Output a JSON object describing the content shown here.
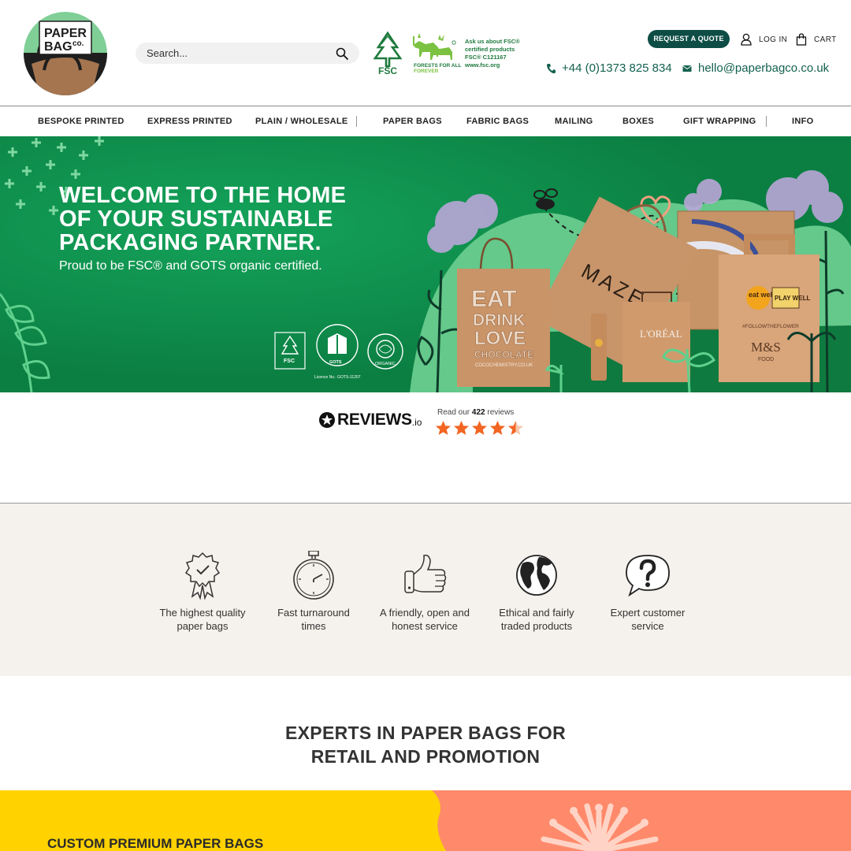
{
  "brand": {
    "logo_line1": "PAPER",
    "logo_line2": "BAG",
    "logo_co": "co."
  },
  "search": {
    "placeholder": "Search..."
  },
  "fsc": {
    "label": "FSC",
    "forests_line1": "FORESTS FOR ALL",
    "forests_line2": "FOREVER",
    "text_lines": [
      "Ask us about FSC®",
      "certified products",
      "FSC® C121167",
      "www.fsc.org"
    ]
  },
  "header": {
    "quote_button": "REQUEST A QUOTE",
    "login": "LOG IN",
    "cart": "CART",
    "phone": "+44 (0)1373 825 834",
    "email": "hello@paperbagco.co.uk"
  },
  "nav": {
    "items": [
      "BESPOKE PRINTED",
      "EXPRESS PRINTED",
      "PLAIN / WHOLESALE",
      "PAPER BAGS",
      "FABRIC BAGS",
      "MAILING",
      "BOXES",
      "GIFT WRAPPING",
      "INFO"
    ]
  },
  "hero": {
    "title_lines": [
      "WELCOME TO THE HOME",
      "OF YOUR SUSTAINABLE",
      "PACKAGING PARTNER."
    ],
    "subtitle": "Proud to be FSC® and GOTS organic certified.",
    "bag_eat": [
      "EAT",
      "DRINK",
      "LOVE",
      "CHOCOLATE"
    ],
    "bag_eat_url": "COCOCHEMISTRY.CO.UK",
    "bag_maze": "MAZE",
    "bag_loreal": "L'ORÉAL",
    "bag_ms": "M&S",
    "bag_ms_food": "FOOD",
    "bag_eatwell": "eat well",
    "bag_playwell": "PLAY WELL",
    "bag_hashtag": "#FOLLOWTHEFLOWER",
    "cert_fsc": "FSC",
    "cert_gots": "GOTS",
    "cert_gots_licence": "Licence No.: GOTS-11207",
    "cert_soil": "ORGANIC"
  },
  "reviews": {
    "brand": "REVIEWS",
    "brand_suffix": ".io",
    "read_prefix": "Read our ",
    "count": "422",
    "read_suffix": " reviews",
    "rating": 4.5,
    "star_color": "#f26522"
  },
  "features": [
    {
      "icon": "rosette-icon",
      "line1": "The highest quality",
      "line2": "paper bags"
    },
    {
      "icon": "stopwatch-icon",
      "line1": "Fast turnaround",
      "line2": "times"
    },
    {
      "icon": "thumbs-up-icon",
      "line1": "A friendly, open and",
      "line2": "honest service"
    },
    {
      "icon": "globe-icon",
      "line1": "Ethical and fairly",
      "line2": "traded products"
    },
    {
      "icon": "question-bubble-icon",
      "line1": "Expert customer",
      "line2": "service"
    }
  ],
  "experts": {
    "line1": "EXPERTS IN PAPER BAGS FOR",
    "line2": "RETAIL AND PROMOTION"
  },
  "band": {
    "title": "CUSTOM PREMIUM PAPER BAGS"
  },
  "colors": {
    "brand_dark_green": "#0d4d45",
    "hero_green": "#0e8a4a",
    "link_green": "#14614f",
    "band_yellow": "#ffd200",
    "band_salmon": "#ff8a6b",
    "features_bg": "#f5f1ec"
  }
}
